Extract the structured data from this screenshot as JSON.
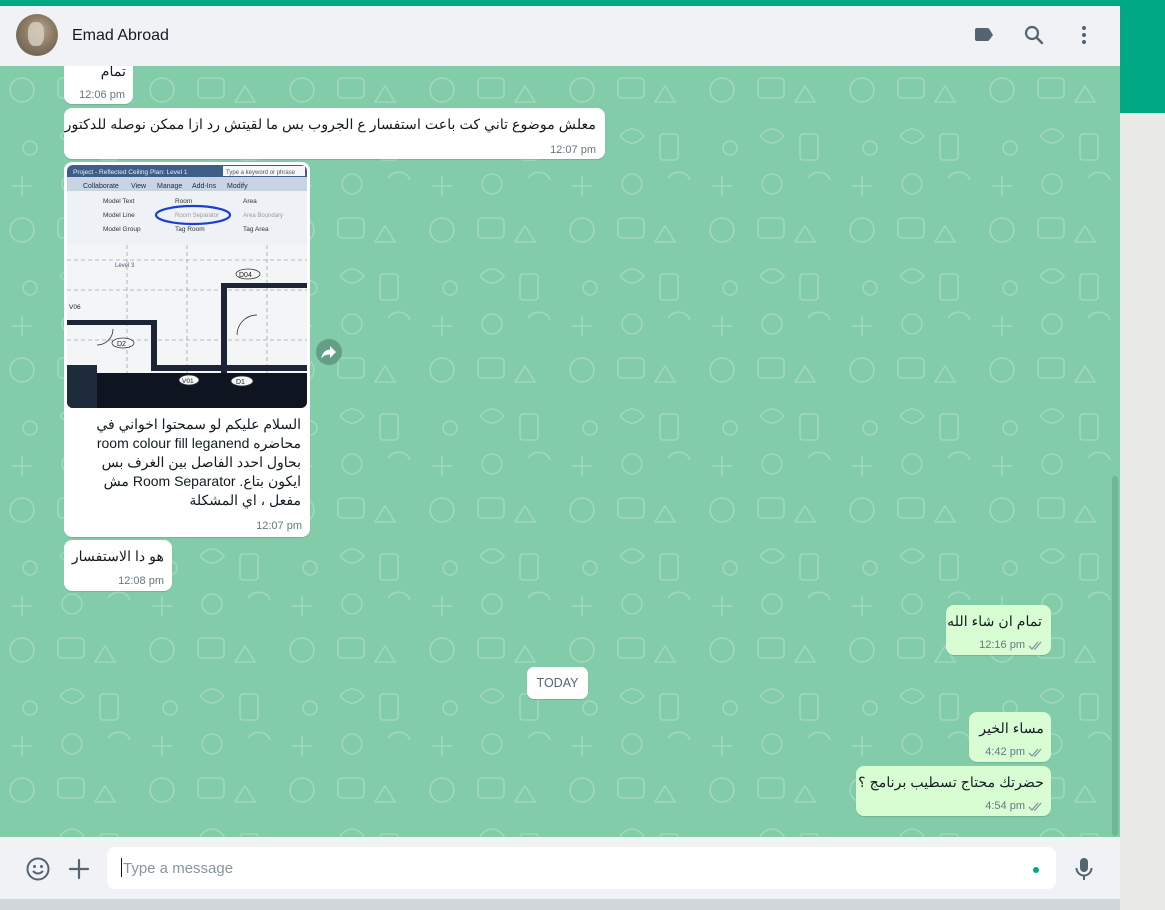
{
  "header": {
    "contact_name": "Emad Abroad",
    "icons": [
      "label-icon",
      "search-icon",
      "menu-icon"
    ]
  },
  "messages": [
    {
      "dir": "in",
      "text": "تمام",
      "time": "12:06 pm"
    },
    {
      "dir": "in",
      "text": "معلش موضوع  تاني كت باعت استفسار ع الجروب بس ما لقيتش رد ازا ممكن نوصله للدكتور",
      "time": "12:07 pm"
    },
    {
      "dir": "in",
      "image": {
        "title_bar": "Project - Reflected Ceiling Plan: Level 1",
        "search_box": "Type a keyword or phrase",
        "tabs": [
          "Collaborate",
          "View",
          "Manage",
          "Add-Ins",
          "Modify"
        ],
        "tools": [
          "Model Text",
          "Model Line",
          "Model Group",
          "Room",
          "Room Separator",
          "Tag Room",
          "Area",
          "Area Boundary",
          "Tag Area"
        ],
        "plan_labels": [
          "Level 3",
          "D04",
          "D2",
          "D1",
          "V01",
          "V06"
        ]
      },
      "caption_lines": [
        "السلام عليكم لو سمحتوا اخواني في",
        "محاضره room colour fill leganend",
        "بحاول احدد الفاصل بين الغرف بس",
        "ايكون بتاع. Room Separator مش",
        "مفعل ، اي المشكلة"
      ],
      "time": "12:07 pm"
    },
    {
      "dir": "in",
      "text": "هو دا الاستفسار",
      "time": "12:08 pm"
    },
    {
      "dir": "out",
      "text": "تمام ان شاء الله",
      "time": "12:16 pm"
    },
    {
      "dir": "out",
      "text": "مساء الخير",
      "time": "4:42 pm"
    },
    {
      "dir": "out",
      "text": "حضرتك محتاج تسطيب برنامج ؟",
      "time": "4:54 pm"
    }
  ],
  "date_divider": "TODAY",
  "composer": {
    "placeholder": "Type a message"
  },
  "colors": {
    "accent": "#00a884",
    "wallpaper": "#82ccaa",
    "outgoing_bubble": "#d9fdd3",
    "incoming_bubble": "#ffffff"
  }
}
